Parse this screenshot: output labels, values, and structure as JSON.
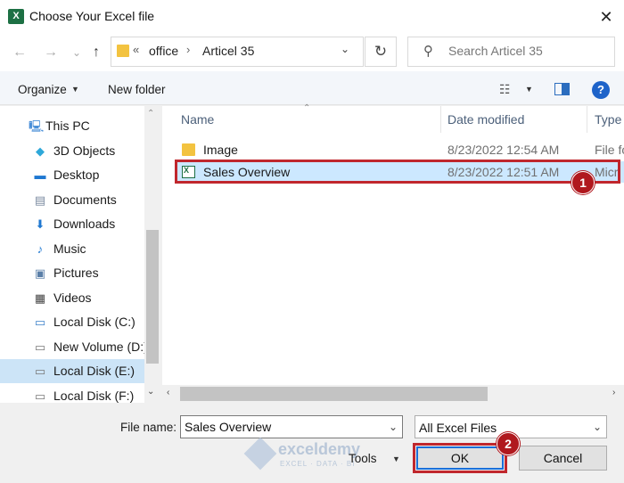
{
  "window": {
    "title": "Choose Your Excel file",
    "close_glyph": "✕",
    "app_icon_letter": "X"
  },
  "address": {
    "prefix": "«",
    "segments": [
      "office",
      "Articel 35"
    ],
    "separator": "›",
    "dropdown_glyph": "⌄",
    "refresh_glyph": "↻",
    "search_placeholder": "Search Articel 35",
    "search_glyph": "⚲"
  },
  "nav_buttons": {
    "back": "←",
    "forward": "→",
    "recent": "⌄",
    "up": "↑"
  },
  "toolbar": {
    "organize_label": "Organize",
    "new_folder_label": "New folder",
    "help_glyph": "?",
    "view_glyph": "☷",
    "drop_glyph": "▼"
  },
  "sidebar": {
    "items": [
      {
        "label": "This PC",
        "icon": "computer-icon",
        "glyph": "🖳",
        "color": "#4a8fd8"
      },
      {
        "label": "3D Objects",
        "icon": "cube-icon",
        "glyph": "◆",
        "color": "#2ea8d9"
      },
      {
        "label": "Desktop",
        "icon": "desktop-icon",
        "glyph": "▬",
        "color": "#1f78d1"
      },
      {
        "label": "Documents",
        "icon": "document-icon",
        "glyph": "▤",
        "color": "#7a8aa0"
      },
      {
        "label": "Downloads",
        "icon": "download-icon",
        "glyph": "⬇",
        "color": "#1f78d1"
      },
      {
        "label": "Music",
        "icon": "music-icon",
        "glyph": "♪",
        "color": "#1f78d1"
      },
      {
        "label": "Pictures",
        "icon": "pictures-icon",
        "glyph": "▣",
        "color": "#5b7fa8"
      },
      {
        "label": "Videos",
        "icon": "video-icon",
        "glyph": "▦",
        "color": "#444444"
      },
      {
        "label": "Local Disk (C:)",
        "icon": "disk-icon",
        "glyph": "▭",
        "color": "#3a7fc9"
      },
      {
        "label": "New Volume (D:)",
        "icon": "disk-icon",
        "glyph": "▭",
        "color": "#777777"
      },
      {
        "label": "Local Disk (E:)",
        "icon": "disk-icon",
        "glyph": "▭",
        "color": "#777777"
      },
      {
        "label": "Local Disk (F:)",
        "icon": "disk-icon",
        "glyph": "▭",
        "color": "#777777"
      }
    ],
    "selected_index": 10
  },
  "filelist": {
    "columns": {
      "name": "Name",
      "date": "Date modified",
      "type": "Type"
    },
    "sort_glyph": "⌃",
    "rows": [
      {
        "name": "Image",
        "date": "8/23/2022 12:54 AM",
        "type": "File fo",
        "kind": "folder"
      },
      {
        "name": "Sales Overview",
        "date": "8/23/2022 12:51 AM",
        "type": "Micr",
        "kind": "excel"
      }
    ],
    "selected_index": 1
  },
  "scroll": {
    "up": "⌃",
    "down": "⌄",
    "left": "‹",
    "right": "›"
  },
  "annotations": {
    "badge1": "1",
    "badge2": "2",
    "outline_color": "#c0272d"
  },
  "bottom": {
    "file_name_label": "File name:",
    "file_name_value": "Sales Overview",
    "file_type": "All Excel Files",
    "tools_label": "Tools",
    "ok_label": "OK",
    "cancel_label": "Cancel",
    "drop_glyph": "⌄",
    "tools_drop_glyph": "▼"
  },
  "watermark": {
    "brand": "exceldemy",
    "tagline": "EXCEL · DATA · BI"
  }
}
